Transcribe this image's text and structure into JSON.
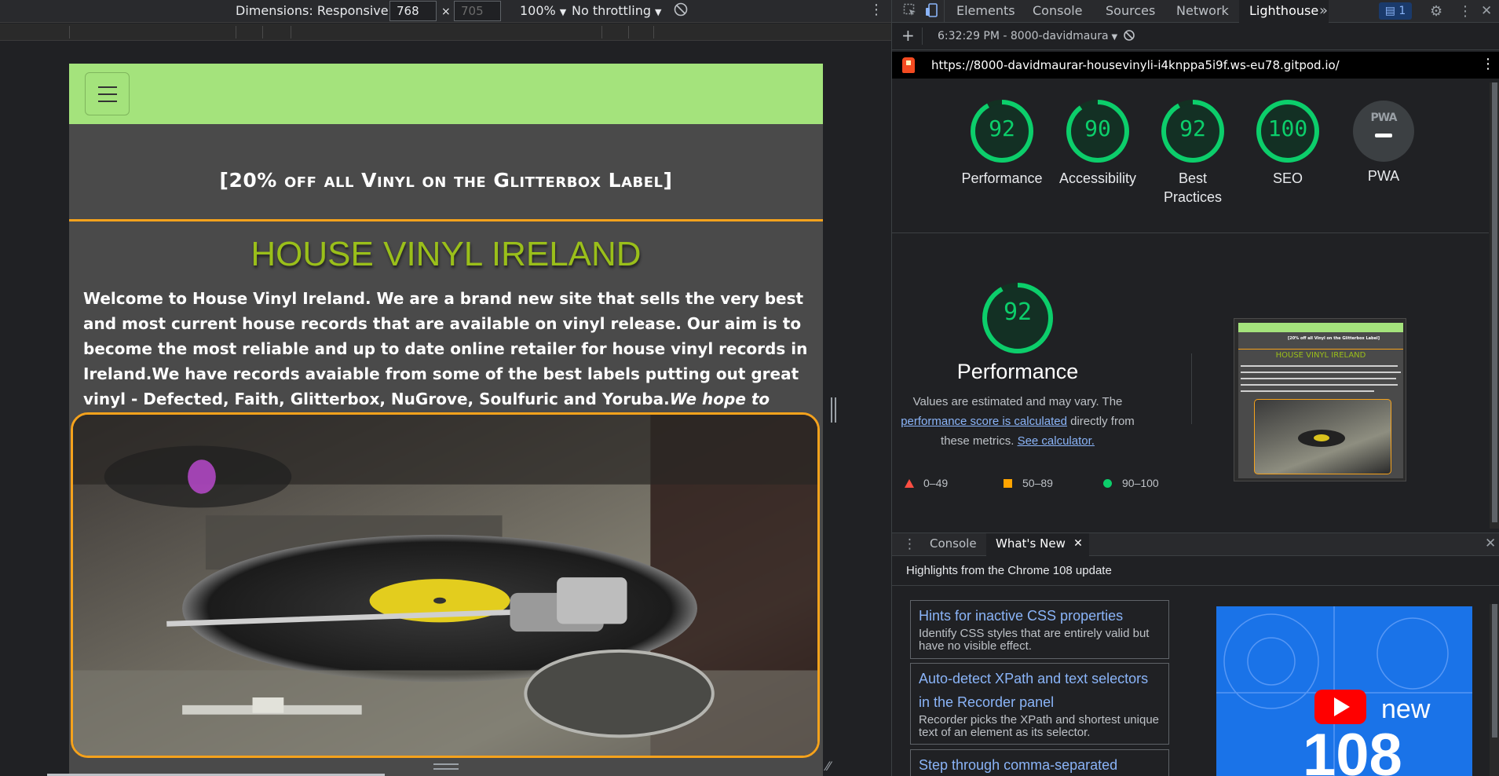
{
  "device_toolbar": {
    "dimensions_label": "Dimensions: Responsive",
    "width_value": "768",
    "height_placeholder": "705",
    "times_sign": "×",
    "zoom": "100%",
    "throttling": "No throttling"
  },
  "site": {
    "promo": "[20% off all Vinyl on the Glitterbox Label]",
    "brand": "HOUSE VINYL IRELAND",
    "intro_text": "Welcome to House Vinyl Ireland. We are a brand new site that sells the very best and most current house records that are available on vinyl release. Our aim is to become the most reliable and up to date online retailer for house vinyl records in Ireland.We have records avaiable from some of the best labels putting out great vinyl - Defected, Faith, Glitterbox, NuGrove, Soulfuric and Yoruba.",
    "intro_italic": "We hope to have even more labels and records available for you in the very future."
  },
  "devtools": {
    "tabs": [
      "Elements",
      "Console",
      "Sources",
      "Network",
      "Lighthouse"
    ],
    "more_tabs": "»",
    "issues_count": "1",
    "report_selector": "6:32:29 PM - 8000-davidmaura",
    "url": "https://8000-davidmaurar-housevinyli-i4knppa5i9f.ws-eu78.gitpod.io/",
    "scores": [
      {
        "label": "Performance",
        "value": 92
      },
      {
        "label": "Accessibility",
        "value": 90
      },
      {
        "label": "Best Practices",
        "value": 92
      },
      {
        "label": "SEO",
        "value": 100
      }
    ],
    "pwa": {
      "label": "PWA",
      "badge": "PWA"
    },
    "perf": {
      "value": 92,
      "title": "Performance",
      "desc_1": "Values are estimated and may vary. The ",
      "desc_link": "performance score is calculated",
      "desc_2": " directly from these metrics. ",
      "desc_link2": "See calculator."
    },
    "legend": {
      "low": "0–49",
      "mid": "50–89",
      "high": "90–100"
    },
    "thumb": {
      "promo": "[20% off all Vinyl on the Glitterbox Label]",
      "title": "HOUSE VINYL IRELAND"
    },
    "drawer": {
      "tab_console": "Console",
      "tab_whatsnew": "What's New",
      "headline": "Highlights from the Chrome 108 update",
      "items": [
        {
          "title": "Hints for inactive CSS properties",
          "desc": "Identify CSS styles that are entirely valid but have no visible effect."
        },
        {
          "title": "Auto-detect XPath and text selectors in the Recorder panel",
          "desc": "Recorder picks the XPath and shortest unique text of an element as its selector."
        },
        {
          "title": "Step through comma-separated",
          "desc": ""
        }
      ],
      "video_new": "new",
      "video_version": "108"
    },
    "colors": {
      "pass": "#0cce6b",
      "average": "#ffa400",
      "fail": "#ff4e42",
      "accent": "#8ab4f8"
    }
  }
}
